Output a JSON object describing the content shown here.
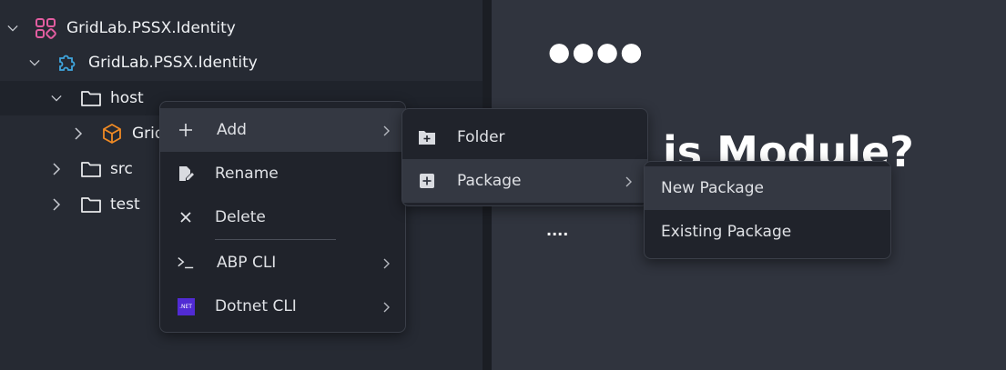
{
  "tree": {
    "items": [
      {
        "label": "GridLab.PSSX.Identity",
        "expanded": true,
        "icon": "solution-icon"
      },
      {
        "label": "GridLab.PSSX.Identity",
        "expanded": true,
        "icon": "module-puzzle-icon"
      },
      {
        "label": "host",
        "expanded": true,
        "icon": "folder-icon"
      },
      {
        "label": "Grid",
        "expanded": false,
        "icon": "package-box-icon"
      },
      {
        "label": "src",
        "expanded": false,
        "icon": "folder-icon"
      },
      {
        "label": "test",
        "expanded": false,
        "icon": "folder-icon"
      }
    ]
  },
  "content": {
    "dots_big": "●●●●",
    "heading": "t is     Module?",
    "dots_small": "...."
  },
  "context_menu": {
    "items": [
      {
        "label": "Add",
        "icon": "plus-icon",
        "has_submenu": true
      },
      {
        "label": "Rename",
        "icon": "rename-icon",
        "has_submenu": false
      },
      {
        "label": "Delete",
        "icon": "close-icon",
        "has_submenu": false
      },
      {
        "label": "ABP CLI",
        "icon": "terminal-icon",
        "has_submenu": true
      },
      {
        "label": "Dotnet CLI",
        "icon": "dotnet-icon",
        "has_submenu": true,
        "icon_text": ".NET"
      }
    ]
  },
  "add_submenu": {
    "items": [
      {
        "label": "Folder",
        "icon": "folder-plus-icon"
      },
      {
        "label": "Package",
        "icon": "square-plus-icon",
        "has_submenu": true
      }
    ]
  },
  "package_submenu": {
    "items": [
      {
        "label": "New Package"
      },
      {
        "label": "Existing Package"
      }
    ]
  },
  "colors": {
    "background": "#262a33",
    "content_bg": "#30343e",
    "menu_bg": "#20232b",
    "menu_highlight": "#343842",
    "solution_icon": "#e25da0",
    "module_icon": "#3fa7e0",
    "package_icon": "#f08a24",
    "dotnet_icon": "#512bd4"
  }
}
